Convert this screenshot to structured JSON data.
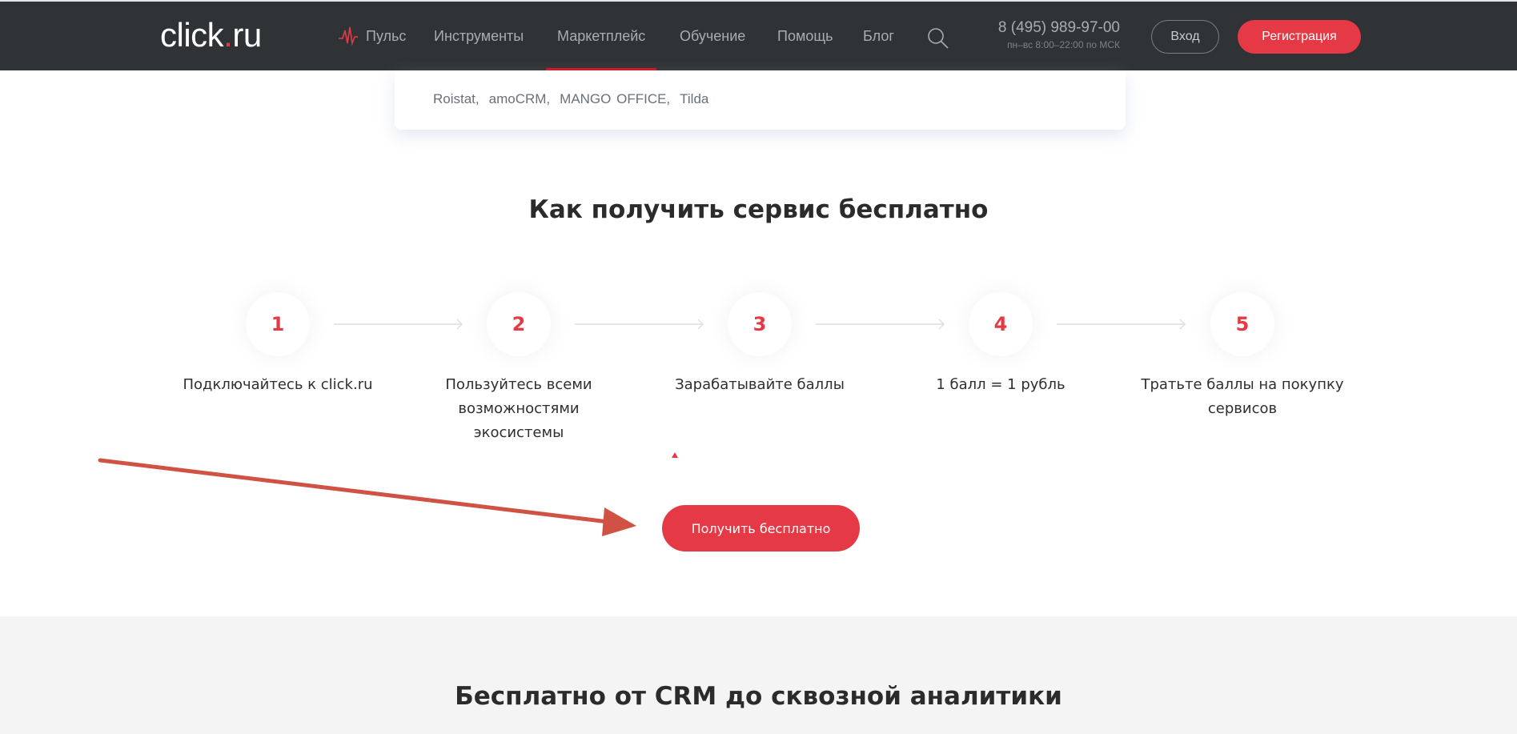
{
  "header": {
    "logo": {
      "main": "click",
      "dot": ".",
      "tld": "ru"
    },
    "nav": [
      {
        "label": "Пульс",
        "icon": "pulse-icon"
      },
      {
        "label": "Инструменты"
      },
      {
        "label": "Маркетплейс",
        "active": true
      },
      {
        "label": "Обучение"
      },
      {
        "label": "Помощь"
      },
      {
        "label": "Блог"
      }
    ],
    "phone": "8 (495) 989-97-00",
    "hours": "пн–вс 8:00–22:00 по МСК",
    "login_label": "Вход",
    "register_label": "Регистрация"
  },
  "partners": [
    "Roistat,",
    "amoCRM,",
    "MANGO OFFICE,",
    "Tilda"
  ],
  "how": {
    "title": "Как получить сервис бесплатно",
    "steps": [
      {
        "num": "1",
        "text": "Подключайтесь к click.ru"
      },
      {
        "num": "2",
        "text": "Пользуйтесь всеми возможностями экосистемы"
      },
      {
        "num": "3",
        "text": "Зарабатывайте баллы"
      },
      {
        "num": "4",
        "text": "1 балл = 1 рубль"
      },
      {
        "num": "5",
        "text": "Тратьте баллы на покупку сервисов"
      }
    ],
    "cta": "Получить бесплатно"
  },
  "next_section": {
    "title": "Бесплатно от CRM до сквозной аналитики"
  },
  "colors": {
    "accent": "#e63946",
    "header_bg": "#303335",
    "annotation": "#d05244"
  }
}
